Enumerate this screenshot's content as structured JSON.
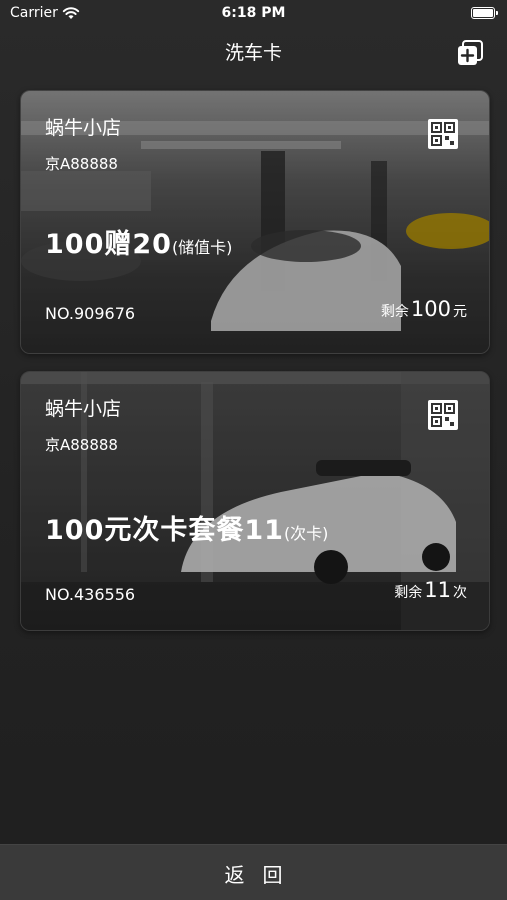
{
  "status": {
    "carrier": "Carrier",
    "time": "6:18 PM"
  },
  "nav": {
    "title": "洗车卡",
    "add_icon": "add-card-icon"
  },
  "cards": [
    {
      "shop": "蜗牛小店",
      "plate": "京A88888",
      "package_title": "100赠20",
      "package_type": "(储值卡)",
      "number": "NO.909676",
      "remaining_label": "剩余",
      "remaining_value": "100",
      "remaining_unit": "元"
    },
    {
      "shop": "蜗牛小店",
      "plate": "京A88888",
      "package_title": "100元次卡套餐11",
      "package_type": "(次卡)",
      "number": "NO.436556",
      "remaining_label": "剩余",
      "remaining_value": "11",
      "remaining_unit": "次"
    }
  ],
  "footer": {
    "back_label": "返回"
  },
  "colors": {
    "background": "#262626",
    "bottom_bar": "#3a3a3a",
    "text": "#ffffff"
  }
}
